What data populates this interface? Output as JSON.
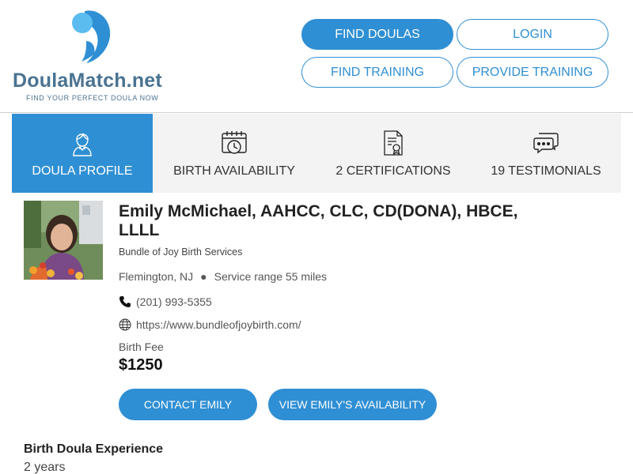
{
  "logo": {
    "wordmark": "DoulaMatch.net",
    "tagline": "FIND YOUR PERFECT DOULA NOW"
  },
  "nav": {
    "find_doulas": "FIND DOULAS",
    "login": "LOGIN",
    "find_training": "FIND TRAINING",
    "provide_training": "PROVIDE TRAINING"
  },
  "tabs": [
    {
      "label": "DOULA PROFILE",
      "icon": "person-icon",
      "active": true
    },
    {
      "label": "BIRTH AVAILABILITY",
      "icon": "calendar-clock-icon",
      "active": false
    },
    {
      "label": "2 CERTIFICATIONS",
      "icon": "certificate-icon",
      "active": false
    },
    {
      "label": "19 TESTIMONIALS",
      "icon": "chat-bubbles-icon",
      "active": false
    }
  ],
  "profile": {
    "name": "Emily McMichael, AAHCC, CLC, CD(DONA), HBCE, LLLL",
    "business": "Bundle of Joy Birth Services",
    "location": "Flemington, NJ",
    "service_range": "Service range 55 miles",
    "phone": "(201) 993-5355",
    "website": "https://www.bundleofjoybirth.com/",
    "fee_label": "Birth Fee",
    "fee_value": "$1250",
    "contact_button": "CONTACT EMILY",
    "availability_button": "VIEW EMILY'S AVAILABILITY"
  },
  "experience": {
    "title": "Birth Doula Experience",
    "value": "2 years"
  },
  "colors": {
    "primary": "#2f8fd4",
    "logo_text": "#4a7391",
    "tab_bg": "#f3f3f3"
  }
}
